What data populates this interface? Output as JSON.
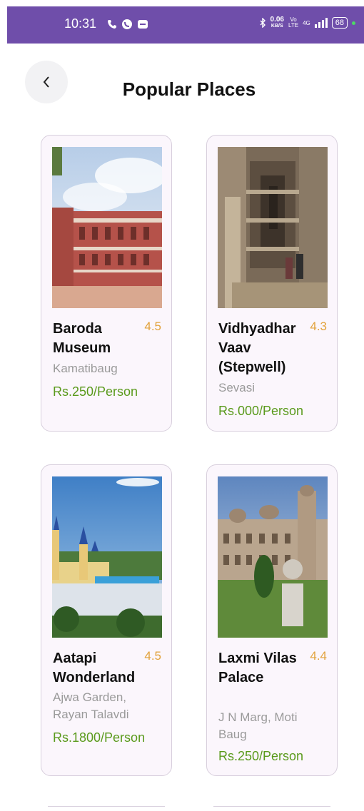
{
  "status_bar": {
    "time": "10:31",
    "speed_value": "0.06",
    "speed_unit": "KB/S",
    "network": "4G",
    "battery": "68"
  },
  "header": {
    "title": "Popular Places",
    "back_icon": "chevron-left-icon"
  },
  "places": [
    {
      "name": "Baroda Museum",
      "rating": "4.5",
      "location": "Kamatibaug",
      "price": "Rs.250/Person"
    },
    {
      "name": "Vidhyadhar Vaav (Stepwell)",
      "rating": "4.3",
      "location": "Sevasi",
      "price": "Rs.000/Person"
    },
    {
      "name": "Aatapi Wonderland",
      "rating": "4.5",
      "location": "Ajwa Garden, Rayan Talavdi",
      "price": "Rs.1800/Person"
    },
    {
      "name": "Laxmi Vilas Palace",
      "rating": "4.4",
      "location": "J N Marg, Moti Baug",
      "price": "Rs.250/Person"
    }
  ],
  "colors": {
    "status_bar": "#6f4eaa",
    "rating": "#e2a23b",
    "price": "#5a9a1c",
    "card_bg": "#fbf6fc"
  }
}
